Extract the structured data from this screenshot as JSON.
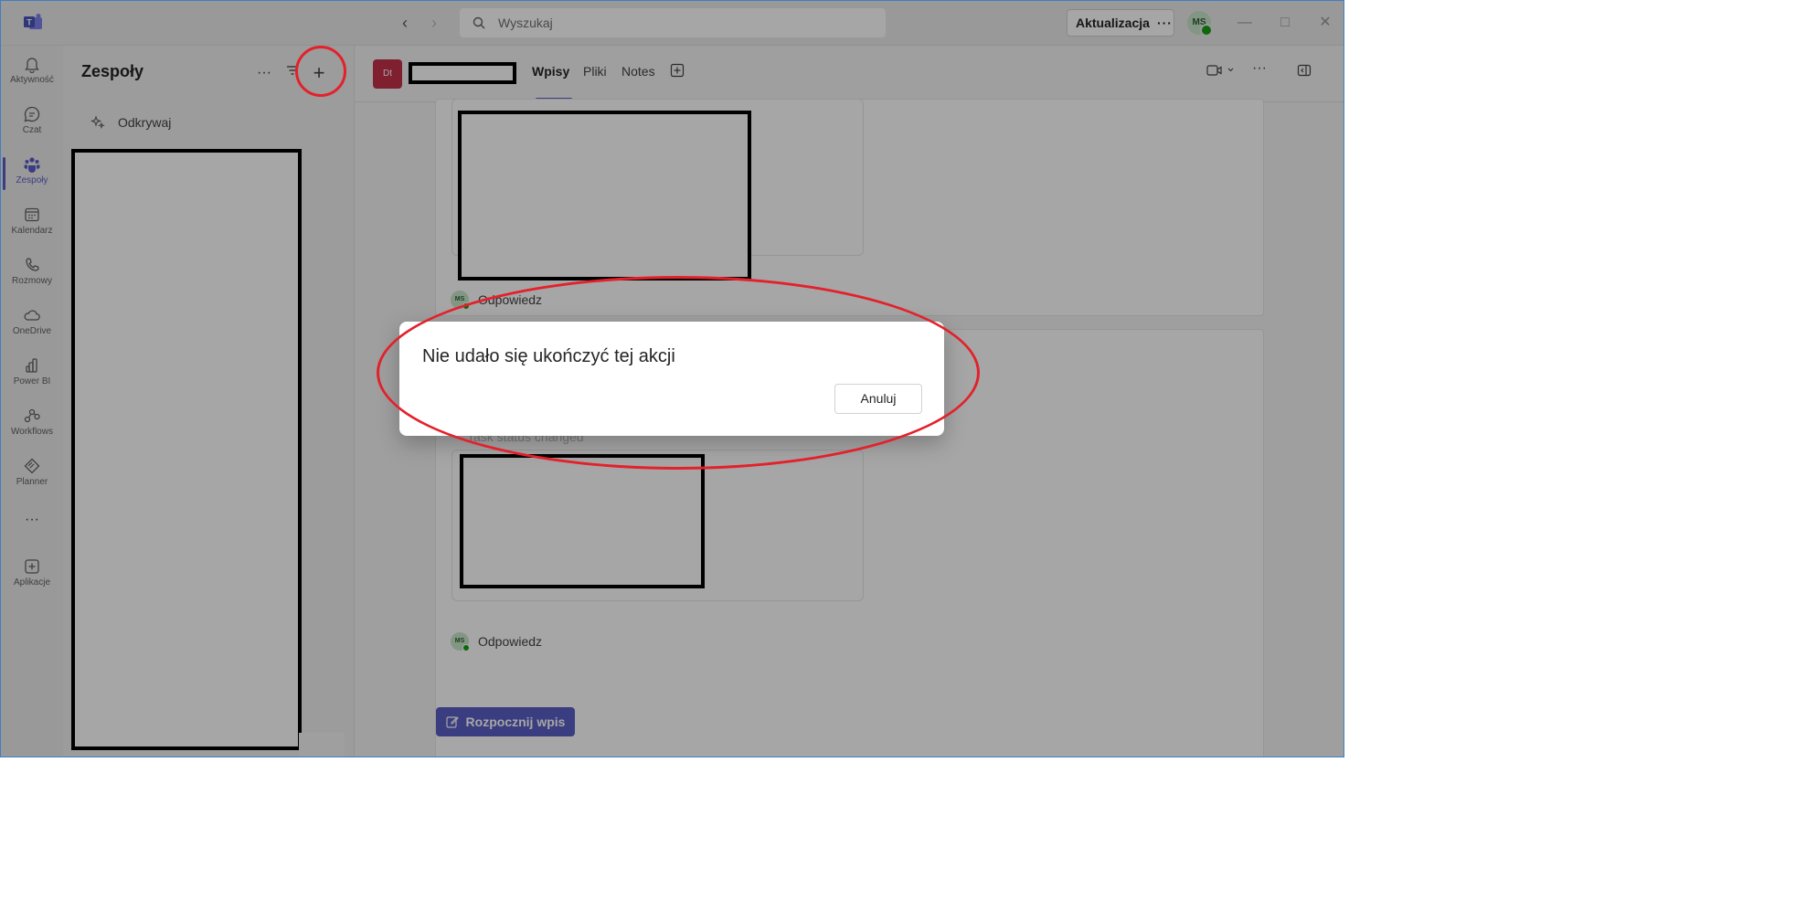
{
  "titlebar": {
    "search_placeholder": "Wyszukaj",
    "update_label": "Aktualizacja",
    "update_more": "···",
    "user_initials": "MS"
  },
  "rail": {
    "items": [
      {
        "label": "Aktywność",
        "icon": "bell-icon"
      },
      {
        "label": "Czat",
        "icon": "chat-icon"
      },
      {
        "label": "Zespoły",
        "icon": "teams-icon"
      },
      {
        "label": "Kalendarz",
        "icon": "calendar-icon"
      },
      {
        "label": "Rozmowy",
        "icon": "phone-icon"
      },
      {
        "label": "OneDrive",
        "icon": "cloud-icon"
      },
      {
        "label": "Power BI",
        "icon": "powerbi-icon"
      },
      {
        "label": "Workflows",
        "icon": "workflows-icon"
      },
      {
        "label": "Planner",
        "icon": "planner-icon"
      },
      {
        "label": "Aplikacje",
        "icon": "add-app-icon"
      }
    ],
    "more_label": "···"
  },
  "panel": {
    "title": "Zespoły",
    "more": "···",
    "discover_label": "Odkrywaj"
  },
  "channel": {
    "badge": "Dt",
    "tabs": [
      {
        "label": "Wpisy"
      },
      {
        "label": "Pliki"
      },
      {
        "label": "Notes"
      }
    ]
  },
  "feed": {
    "reply_label": "Odpowiedz",
    "reply_initials": "MS",
    "partial_text": "Task status changed",
    "start_post_label": "Rozpocznij wpis"
  },
  "dialog": {
    "title": "Nie udało się ukończyć tej akcji",
    "cancel_label": "Anuluj"
  },
  "colors": {
    "accent": "#5b5fc7",
    "annotation": "#e3212b",
    "badge": "#c4314b"
  }
}
